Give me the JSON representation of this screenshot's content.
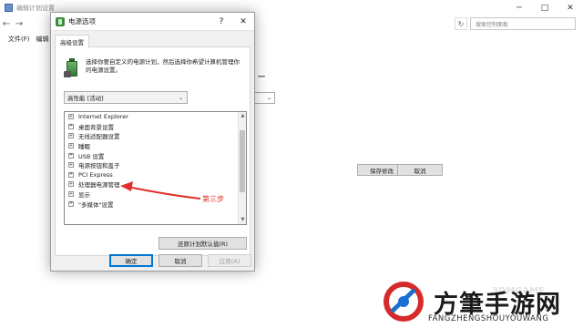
{
  "background_window": {
    "title": "编辑计划设置",
    "search_placeholder": "搜索控制面板",
    "menu": [
      "文件(F)",
      "编辑"
    ],
    "side_heading": "一",
    "buttons": {
      "save": "保存修改",
      "cancel": "取消"
    },
    "controls": {
      "minimize": "─",
      "maximize": "□",
      "close": "✕"
    }
  },
  "dialog": {
    "title": "电源选项",
    "help": "?",
    "close": "✕",
    "tab_label": "高级设置",
    "description": "选择你要自定义的电源计划，然后选择你希望计算机管理你的电源设置。",
    "plan_select_value": "高性能 [活动]",
    "tree_items": [
      "Internet Explorer",
      "桌面背景设置",
      "无线适配器设置",
      "睡眠",
      "USB 设置",
      "电源按钮和盖子",
      "PCI Express",
      "处理器电源管理",
      "显示",
      "\"多媒体\"设置"
    ],
    "expander_glyph": "+",
    "restore_button": "还原计划默认值(R)",
    "buttons": {
      "ok": "确定",
      "cancel": "取消",
      "apply": "应用(A)"
    }
  },
  "annotation": {
    "label": "第三步",
    "color": "#e0302a"
  },
  "watermark": {
    "name": "方筆手游网",
    "url": "FANGZHENGSHOUYOUWANG",
    "badge": "3DMGAME"
  }
}
